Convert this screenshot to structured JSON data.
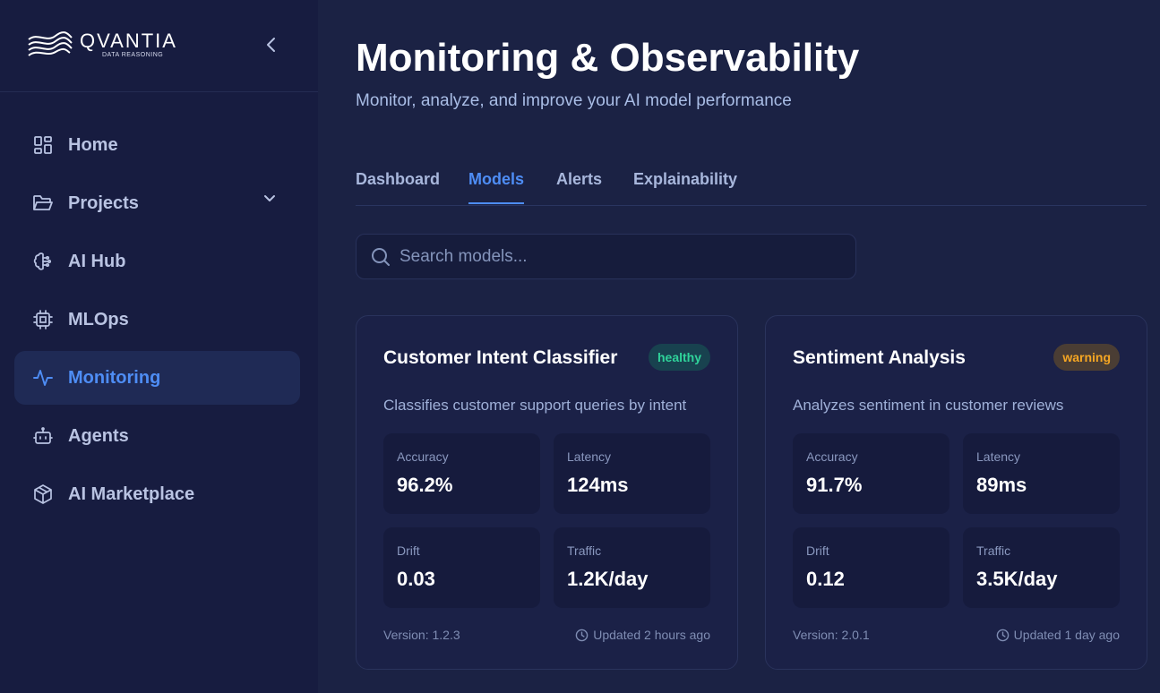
{
  "brand": {
    "name": "QVANTIA",
    "tagline": "DATA REASONING"
  },
  "sidebar": {
    "items": [
      {
        "label": "Home",
        "icon": "home-grid-icon",
        "active": false
      },
      {
        "label": "Projects",
        "icon": "folder-icon",
        "active": false,
        "expandable": true
      },
      {
        "label": "AI Hub",
        "icon": "brain-icon",
        "active": false
      },
      {
        "label": "MLOps",
        "icon": "cpu-chip-icon",
        "active": false
      },
      {
        "label": "Monitoring",
        "icon": "activity-pulse-icon",
        "active": true
      },
      {
        "label": "Agents",
        "icon": "bot-icon",
        "active": false
      },
      {
        "label": "AI Marketplace",
        "icon": "package-box-icon",
        "active": false
      }
    ]
  },
  "header": {
    "title": "Monitoring & Observability",
    "subtitle": "Monitor, analyze, and improve your AI model performance"
  },
  "tabs": [
    {
      "label": "Dashboard",
      "active": false
    },
    {
      "label": "Models",
      "active": true
    },
    {
      "label": "Alerts",
      "active": false
    },
    {
      "label": "Explainability",
      "active": false
    }
  ],
  "search": {
    "placeholder": "Search models...",
    "value": ""
  },
  "models": [
    {
      "name": "Customer Intent Classifier",
      "status": "healthy",
      "description": "Classifies customer support queries by intent",
      "metrics": {
        "accuracy_label": "Accuracy",
        "accuracy": "96.2%",
        "latency_label": "Latency",
        "latency": "124ms",
        "drift_label": "Drift",
        "drift": "0.03",
        "traffic_label": "Traffic",
        "traffic": "1.2K/day"
      },
      "version": "Version: 1.2.3",
      "updated": "Updated 2 hours ago"
    },
    {
      "name": "Sentiment Analysis",
      "status": "warning",
      "description": "Analyzes sentiment in customer reviews",
      "metrics": {
        "accuracy_label": "Accuracy",
        "accuracy": "91.7%",
        "latency_label": "Latency",
        "latency": "89ms",
        "drift_label": "Drift",
        "drift": "0.12",
        "traffic_label": "Traffic",
        "traffic": "3.5K/day"
      },
      "version": "Version: 2.0.1",
      "updated": "Updated 1 day ago"
    }
  ],
  "colors": {
    "accent": "#4e8df5",
    "healthy": "#2fd39a",
    "warning": "#f5a623",
    "sidebar_bg": "#171c40",
    "main_bg": "#1b2244"
  }
}
